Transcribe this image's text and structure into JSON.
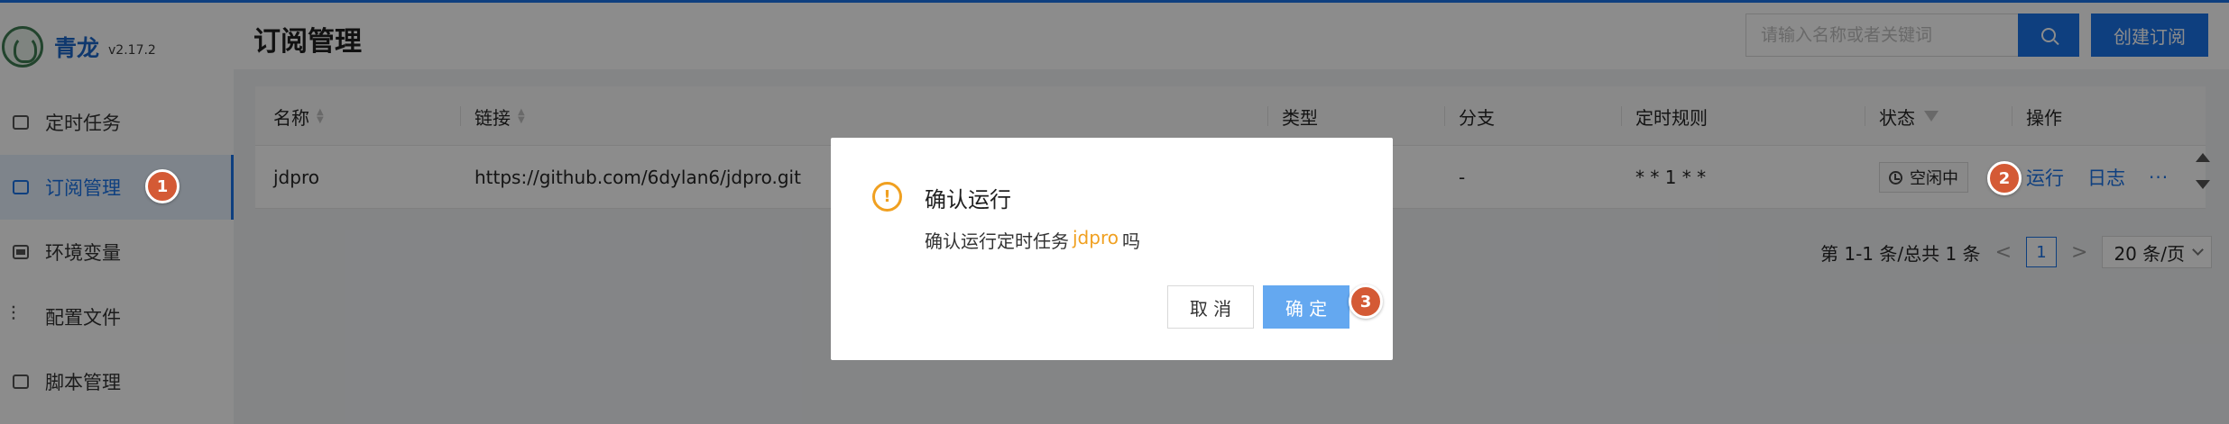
{
  "app": {
    "name": "青龙",
    "version": "v2.17.2"
  },
  "sidebar": {
    "items": [
      {
        "label": "定时任务",
        "icon": "calendar-icon"
      },
      {
        "label": "订阅管理",
        "icon": "subscription-icon",
        "active": true
      },
      {
        "label": "环境变量",
        "icon": "monitor-icon"
      },
      {
        "label": "配置文件",
        "icon": "sliders-icon"
      },
      {
        "label": "脚本管理",
        "icon": "script-icon"
      }
    ]
  },
  "header": {
    "title": "订阅管理",
    "search_placeholder": "请输入名称或者关键词",
    "create_label": "创建订阅"
  },
  "table": {
    "columns": [
      "名称",
      "链接",
      "类型",
      "分支",
      "定时规则",
      "状态",
      "操作"
    ],
    "rows": [
      {
        "name": "jdpro",
        "url": "https://github.com/6dylan6/jdpro.git",
        "type": "",
        "branch": "-",
        "schedule": "* * 1 * *",
        "status": "空闲中",
        "actions": [
          "运行",
          "日志",
          "···"
        ]
      }
    ]
  },
  "pagination": {
    "summary": "第 1-1 条/总共 1 条",
    "prev": "<",
    "current": "1",
    "next": ">",
    "page_size": "20 条/页"
  },
  "modal": {
    "title": "确认运行",
    "message_prefix": "确认运行定时任务",
    "task_name": "jdpro",
    "message_suffix": "吗",
    "cancel_label": "取 消",
    "ok_label": "确 定"
  },
  "step_badges": [
    "1",
    "2",
    "3"
  ],
  "colors": {
    "primary": "#1a73e8",
    "warning": "#f0a020",
    "badge": "#d45a35",
    "confirm_button": "#64a8f0"
  }
}
